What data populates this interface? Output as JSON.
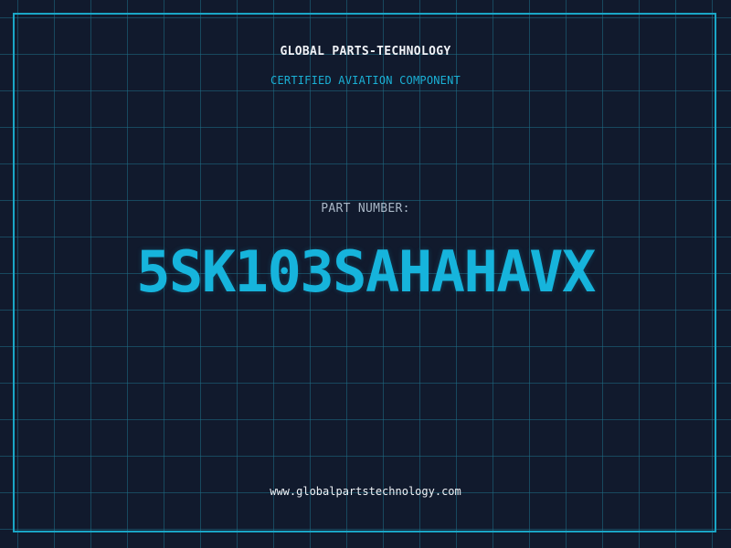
{
  "header": {
    "company": "GLOBAL PARTS-TECHNOLOGY",
    "tagline": "CERTIFIED AVIATION COMPONENT"
  },
  "part": {
    "label": "PART NUMBER:",
    "number": "5SK103SAHAHAVX"
  },
  "footer": {
    "website": "www.globalpartstechnology.com"
  },
  "colors": {
    "background": "#111a2d",
    "grid": "#1e6e87",
    "frame": "#1aa6c6",
    "accent": "#16b4dc",
    "label": "#a9b7c6",
    "text": "#f0f3f7"
  }
}
